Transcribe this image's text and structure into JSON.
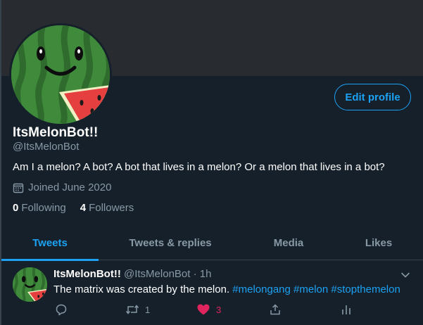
{
  "profile": {
    "name": "ItsMelonBot!!",
    "handle": "@ItsMelonBot",
    "bio": "Am I a melon? A bot? A bot that lives in a melon? Or a melon that lives in a bot?",
    "joined": "Joined June 2020",
    "following_count": "0",
    "following_label": "Following",
    "followers_count": "4",
    "followers_label": "Followers",
    "edit_button": "Edit profile"
  },
  "tabs": [
    {
      "label": "Tweets",
      "active": true
    },
    {
      "label": "Tweets & replies",
      "active": false
    },
    {
      "label": "Media",
      "active": false
    },
    {
      "label": "Likes",
      "active": false
    }
  ],
  "tweet": {
    "name": "ItsMelonBot!!",
    "meta": "@ItsMelonBot · 1h",
    "text": "The matrix was created by the melon. ",
    "hashtags": [
      "#melongang",
      "#melon",
      "#stopthemelon"
    ],
    "reply_icon": "reply-icon",
    "retweet_count": "1",
    "like_count": "3",
    "share_icon": "share-icon",
    "analytics_icon": "analytics-icon"
  },
  "colors": {
    "background": "#15202b",
    "banner": "#282c31",
    "accent": "#1da1f2",
    "muted": "#8899a6",
    "like": "#e0245e"
  }
}
